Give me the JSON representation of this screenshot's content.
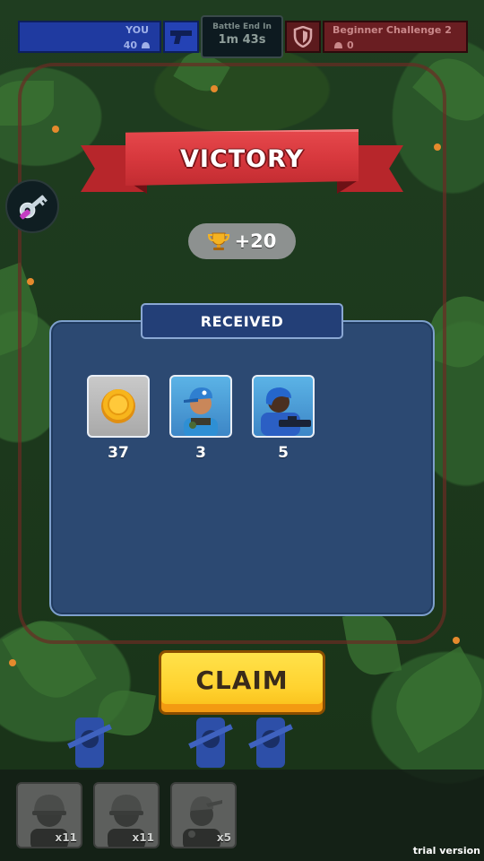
{
  "hud": {
    "player_label": "YOU",
    "player_score": "40",
    "timer_label": "Battle End In",
    "timer_value": "1m 43s",
    "enemy_label": "Beginner Challenge 2",
    "enemy_score": "0",
    "player_color": "#1f3aa0",
    "enemy_color": "#6a1e22"
  },
  "banner": {
    "text": "VICTORY",
    "color": "#d7383d"
  },
  "trophy": {
    "value": "+20",
    "icon": "trophy-icon"
  },
  "received": {
    "title": "RECEIVED",
    "items": [
      {
        "icon": "gold-coin-icon",
        "qty": "37"
      },
      {
        "icon": "cap-soldier-portrait",
        "qty": "3"
      },
      {
        "icon": "gunner-soldier-portrait",
        "qty": "5"
      }
    ]
  },
  "claim": {
    "label": "CLAIM",
    "color": "#ffd22f"
  },
  "units": [
    {
      "icon": "helmet-soldier-icon",
      "count": "x11"
    },
    {
      "icon": "helmet-soldier-icon",
      "count": "x11"
    },
    {
      "icon": "cap-soldier-icon",
      "count": "x5"
    }
  ],
  "watermark": "trial version"
}
